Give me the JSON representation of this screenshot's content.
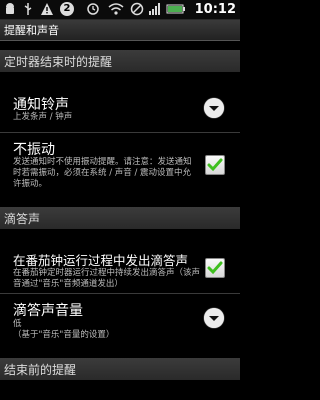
{
  "status": {
    "time": "10:12",
    "notification_count": "2"
  },
  "title": "提醒和声音",
  "sections": {
    "timer_end": "定时器结束时的提醒",
    "tick": "滴答声",
    "before_end": "结束前的提醒"
  },
  "items": {
    "ringtone": {
      "title": "通知铃声",
      "subtitle": "上发条声 / 钟声"
    },
    "no_vibrate": {
      "title": "不振动",
      "subtitle": "发送通知时不使用振动提醒。请注意：发送通知时若需振动，必须在系统 / 声音 / 震动设置中允许振动。"
    },
    "tick_during": {
      "title": "在番茄钟运行过程中发出滴答声",
      "subtitle": "在番茄钟定时器运行过程中持续发出滴答声（该声音通过\"音乐\"音频通道发出）"
    },
    "tick_volume": {
      "title": "滴答声音量",
      "subtitle_value": "低",
      "subtitle_note": "（基于\"音乐\"音量的设置）"
    }
  },
  "colors": {
    "check": "#3fbf1f",
    "battery": "#4caf50"
  }
}
